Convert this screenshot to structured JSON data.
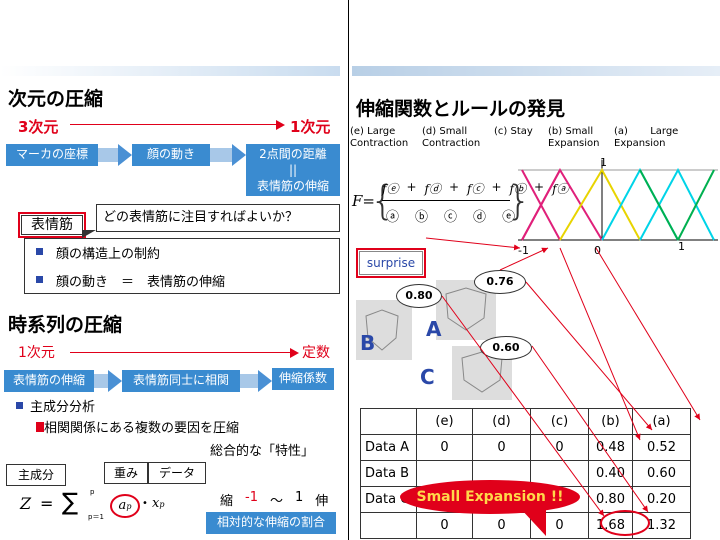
{
  "left": {
    "section1_title": "次元の圧縮",
    "from_dim": "3次元",
    "to_dim": "1次元",
    "boxes": [
      "マーカの座標",
      "顔の動き",
      "2点間の距離",
      "||",
      "表情筋の伸縮"
    ],
    "muscle_label": "表情筋",
    "question": "どの表情筋に注目すればよいか？",
    "bullets": [
      "顔の構造上の制約",
      "顔の動き　＝　表情筋の伸縮"
    ],
    "section2_title": "時系列の圧縮",
    "from2": "1次元",
    "to2": "定数",
    "boxes2": [
      "表情筋の伸縮",
      "表情筋同士に相関",
      "伸縮係数"
    ],
    "pca": "主成分分析",
    "pca_sub": "相関関係にある複数の要因を圧縮",
    "pca_sub2": "総合的な「特性」",
    "formula_labels": [
      "主成分",
      "重み",
      "データ"
    ],
    "formula": {
      "lhs": "Z",
      "eq": "=",
      "sum": "∑",
      "sup": "p",
      "sub": "p＝1",
      "a": "a",
      "ap": "p",
      "x": "x",
      "xp": "p"
    },
    "scale": {
      "shrink": "縮",
      "min": "-1",
      "tilde": "～",
      "max": "1",
      "stretch": "伸"
    },
    "scale_note": "相対的な伸縮の割合"
  },
  "right": {
    "title": "伸縮関数とルールの発見",
    "legend": [
      {
        "key": "(e)",
        "l1": "Large",
        "l2": "Contraction"
      },
      {
        "key": "(d)",
        "l1": "Small",
        "l2": "Contraction"
      },
      {
        "key": "(c)",
        "l1": "Stay",
        "l2": ""
      },
      {
        "key": "(b)",
        "l1": "Small",
        "l2": "Expansion"
      },
      {
        "key": "(a)",
        "l1": "Large",
        "l2": "Expansion"
      }
    ],
    "axis_top": "1",
    "axis_left": "-1",
    "axis_mid": "0",
    "axis_right": "1",
    "surprise": "surprise",
    "faces": [
      "B",
      "A",
      "C"
    ],
    "face_values": [
      "0.80",
      "0.76",
      "0.60"
    ],
    "formula_F": "F",
    "formula_f": [
      "fⓔ",
      "fⓓ",
      "fⓒ",
      "fⓑ",
      "fⓐ"
    ],
    "formula_den": [
      "ⓐ",
      "ⓑ",
      "ⓒ",
      "ⓓ",
      "ⓔ"
    ],
    "table": {
      "headers": [
        "",
        "(e)",
        "(d)",
        "(c)",
        "(b)",
        "(a)"
      ],
      "rows": [
        [
          "Data A",
          "0",
          "0",
          "0",
          "0.48",
          "0.52"
        ],
        [
          "Data B",
          "",
          "",
          "",
          "0.40",
          "0.60"
        ],
        [
          "Data C",
          "",
          "",
          "",
          "0.80",
          "0.20"
        ],
        [
          "",
          "0",
          "0",
          "0",
          "1.68",
          "1.32"
        ]
      ]
    },
    "callout": "Small Expansion !!"
  },
  "colors": {
    "blue_box": "#3a8bd0",
    "red": "#e0001a",
    "magenta": "#e0207a",
    "yellow": "#e8d400",
    "cyan": "#00d4e8",
    "green": "#00b050"
  }
}
